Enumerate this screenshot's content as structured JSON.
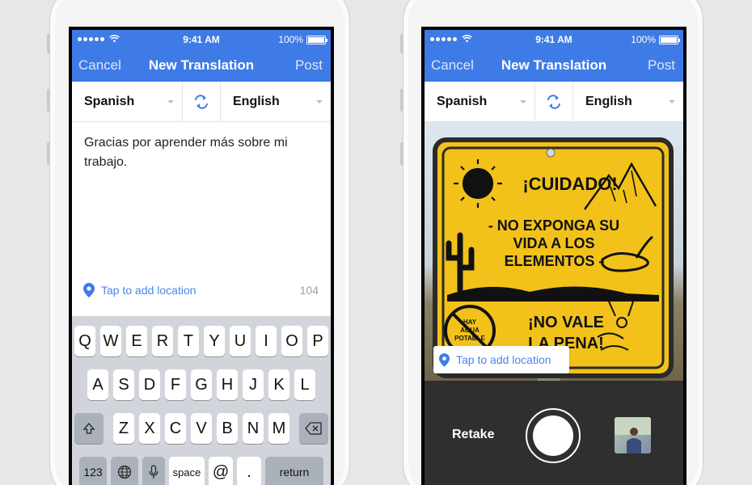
{
  "status": {
    "time": "9:41 AM",
    "battery": "100%"
  },
  "nav": {
    "cancel": "Cancel",
    "title": "New Translation",
    "post": "Post"
  },
  "languages": {
    "source": "Spanish",
    "target": "English"
  },
  "left_screen": {
    "input_text": "Gracias por aprender más sobre mi trabajo.",
    "location_label": "Tap to add location",
    "char_count": "104",
    "keyboard": {
      "row1": [
        "Q",
        "W",
        "E",
        "R",
        "T",
        "Y",
        "U",
        "I",
        "O",
        "P"
      ],
      "row2": [
        "A",
        "S",
        "D",
        "F",
        "G",
        "H",
        "J",
        "K",
        "L"
      ],
      "row3": [
        "Z",
        "X",
        "C",
        "V",
        "B",
        "N",
        "M"
      ],
      "numbers": "123",
      "space": "space",
      "at": "@",
      "period": ".",
      "return": "return"
    }
  },
  "right_screen": {
    "sign_lines": [
      "¡CUIDADO!",
      "- NO EXPONGA SU",
      "VIDA A LOS",
      "ELEMENTOS -",
      "¡NO VALE",
      "LA PENA!",
      "HAY",
      "AGUA",
      "POTABLE"
    ],
    "location_label": "Tap to add location",
    "retake": "Retake"
  },
  "colors": {
    "accent": "#3f7be6",
    "link": "#4a86e8",
    "sign": "#f2c21b",
    "camera_bar": "#2f2f2f"
  }
}
